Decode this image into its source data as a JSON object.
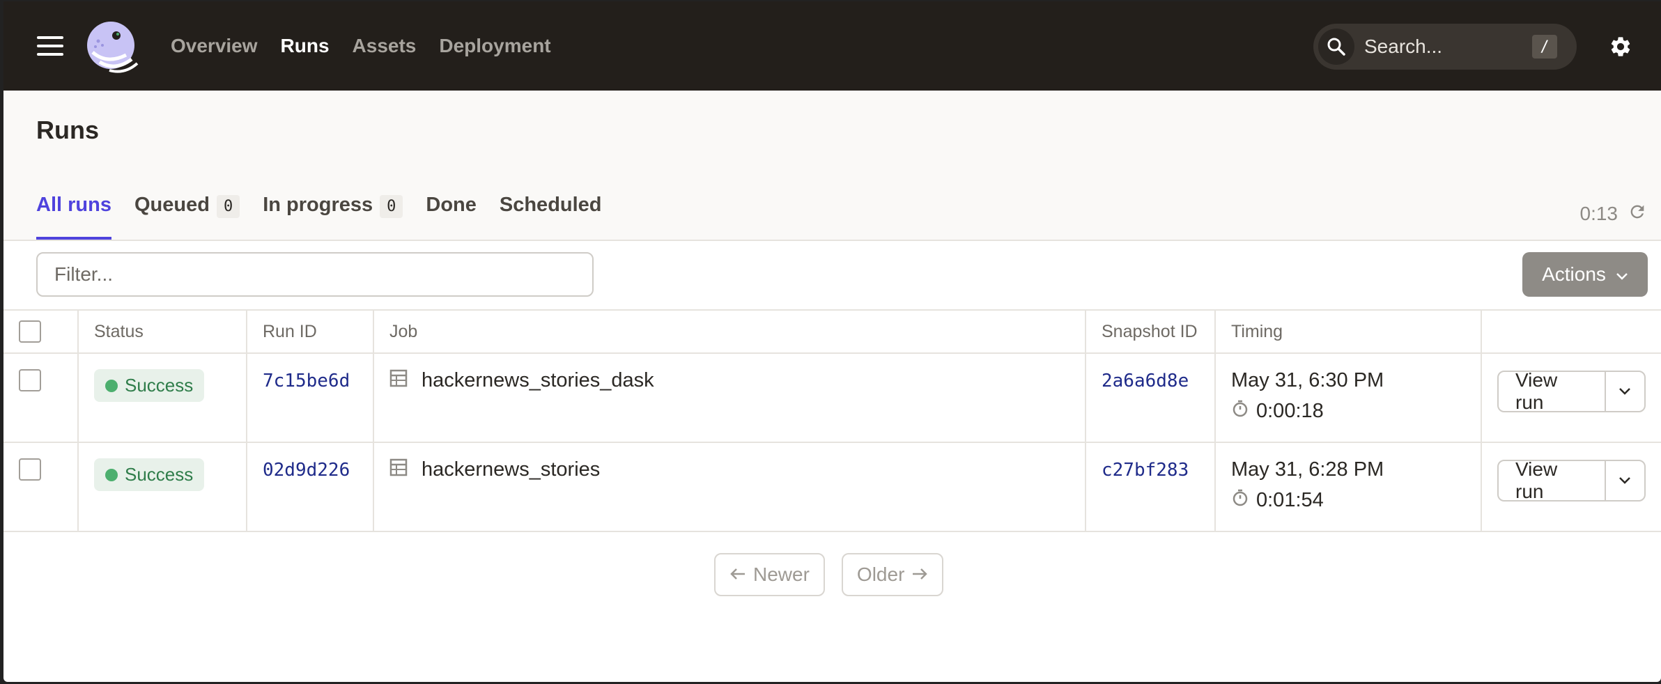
{
  "topbar": {
    "menu_icon": "hamburger-icon",
    "logo_icon": "dagster-logo",
    "nav": [
      {
        "label": "Overview",
        "active": false
      },
      {
        "label": "Runs",
        "active": true
      },
      {
        "label": "Assets",
        "active": false
      },
      {
        "label": "Deployment",
        "active": false
      }
    ],
    "search": {
      "label": "Search...",
      "shortcut": "/"
    },
    "settings_icon": "gear-icon"
  },
  "page": {
    "title": "Runs",
    "tabs": [
      {
        "label": "All runs",
        "count": null,
        "active": true
      },
      {
        "label": "Queued",
        "count": "0",
        "active": false
      },
      {
        "label": "In progress",
        "count": "0",
        "active": false
      },
      {
        "label": "Done",
        "count": null,
        "active": false
      },
      {
        "label": "Scheduled",
        "count": null,
        "active": false
      }
    ],
    "refresh_timer": "0:13"
  },
  "filter": {
    "placeholder": "Filter..."
  },
  "actions": {
    "label": "Actions"
  },
  "table": {
    "headers": {
      "status": "Status",
      "run_id": "Run ID",
      "job": "Job",
      "snapshot_id": "Snapshot ID",
      "timing": "Timing"
    },
    "rows": [
      {
        "status": "Success",
        "run_id": "7c15be6d",
        "job": "hackernews_stories_dask",
        "snapshot_id": "2a6a6d8e",
        "date": "May 31, 6:30 PM",
        "duration": "0:00:18",
        "action": "View run"
      },
      {
        "status": "Success",
        "run_id": "02d9d226",
        "job": "hackernews_stories",
        "snapshot_id": "c27bf283",
        "date": "May 31, 6:28 PM",
        "duration": "0:01:54",
        "action": "View run"
      }
    ]
  },
  "pagination": {
    "newer": "Newer",
    "older": "Older"
  },
  "colors": {
    "topbar_bg": "#231f1b",
    "accent": "#4f43dd",
    "success": "#4caf6e",
    "link": "#1f2b8a"
  }
}
